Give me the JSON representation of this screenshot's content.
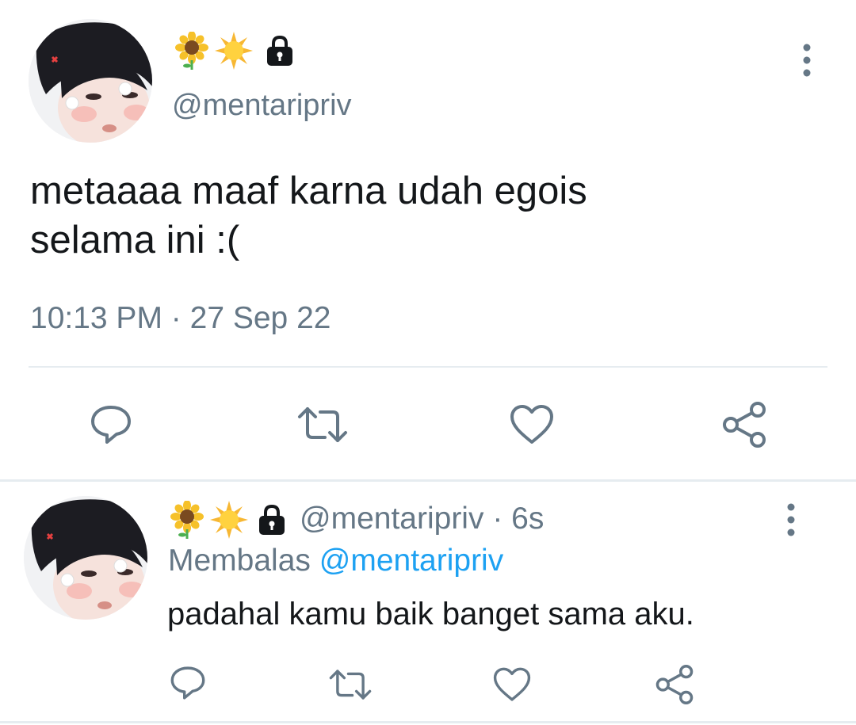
{
  "main_tweet": {
    "handle": "@mentaripriv",
    "text_line1": "metaaaa maaf karna udah egois",
    "text_line2": "selama ini :(",
    "time": "10:13 PM",
    "separator": "·",
    "date": "27 Sep 22",
    "name_emojis": [
      "sunflower-emoji",
      "sun-emoji",
      "lock-icon"
    ]
  },
  "reply_tweet": {
    "handle": "@mentaripriv",
    "separator": "·",
    "age": "6s",
    "replying_prefix": "Membalas",
    "replying_mention": "@mentaripriv",
    "text": "padahal kamu baik banget sama aku.",
    "name_emojis": [
      "sunflower-emoji",
      "sun-emoji",
      "lock-icon"
    ]
  },
  "actions": [
    "reply-icon",
    "retweet-icon",
    "like-icon",
    "share-icon"
  ],
  "colors": {
    "text": "#14171a",
    "secondary": "#657786",
    "mention": "#1da1f2",
    "divider": "#e6ecf0"
  }
}
